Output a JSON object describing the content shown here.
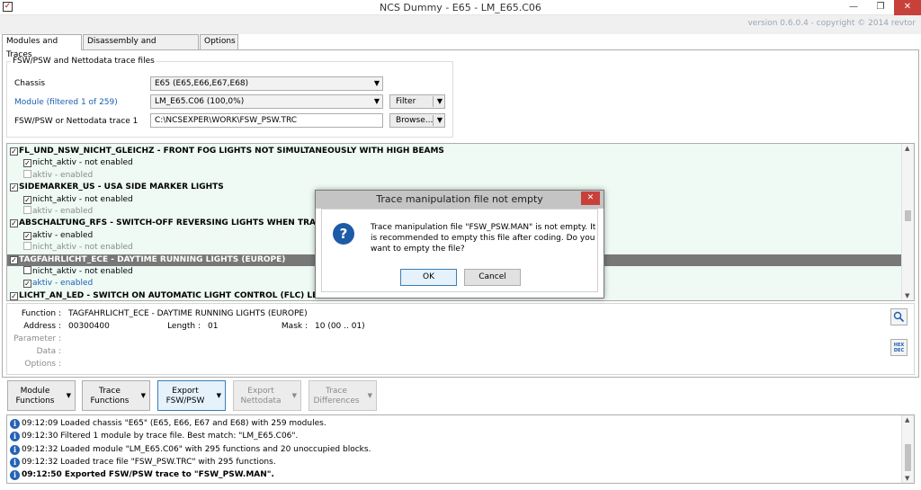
{
  "window": {
    "title": "NCS Dummy - E65 - LM_E65.C06",
    "version": "version 0.6.0.4 - copyright © 2014 revtor",
    "minimize": "—",
    "maximize": "❐",
    "close": "✕"
  },
  "tabs": [
    "Modules and Traces",
    "Disassembly and Checksums",
    "Options"
  ],
  "trace_group": {
    "title": "FSW/PSW and Nettodata trace files",
    "chassis_label": "Chassis",
    "chassis_value": "E65  (E65,E66,E67,E68)",
    "module_label": "Module (filtered 1 of 259)",
    "module_value": "LM_E65.C06  (100,0%)",
    "filter_button": "Filter",
    "trace_label": "FSW/PSW or Nettodata trace 1",
    "trace_value": "C:\\NCSEXPER\\WORK\\FSW_PSW.TRC",
    "browse_button": "Browse..."
  },
  "function_list": [
    {
      "type": "func",
      "text": "FL_UND_NSW_NICHT_GLEICHZ  -  FRONT FOG LIGHTS NOT SIMULTANEOUSLY WITH HIGH BEAMS",
      "checked": true,
      "selected": false
    },
    {
      "type": "opt",
      "text": "nicht_aktiv  -  not enabled",
      "checked": true,
      "state": "normal"
    },
    {
      "type": "opt",
      "text": "aktiv  -  enabled",
      "checked": false,
      "state": "disabled"
    },
    {
      "type": "func",
      "text": "SIDEMARKER_US  -  USA SIDE MARKER LIGHTS",
      "checked": true,
      "selected": false
    },
    {
      "type": "opt",
      "text": "nicht_aktiv  -  not enabled",
      "checked": true,
      "state": "normal"
    },
    {
      "type": "opt",
      "text": "aktiv  -  enabled",
      "checked": false,
      "state": "disabled"
    },
    {
      "type": "func",
      "text": "ABSCHALTUNG_RFS  -  SWITCH-OFF REVERSING LIGHTS WHEN TRAILER ATTACHED",
      "checked": true,
      "selected": false
    },
    {
      "type": "opt",
      "text": "aktiv  -  enabled",
      "checked": true,
      "state": "normal"
    },
    {
      "type": "opt",
      "text": "nicht_aktiv  -  not enabled",
      "checked": false,
      "state": "disabled"
    },
    {
      "type": "func",
      "text": "TAGFAHRLICHT_ECE  -  DAYTIME RUNNING LIGHTS (EUROPE)",
      "checked": true,
      "selected": true
    },
    {
      "type": "opt",
      "text": "nicht_aktiv  -  not enabled",
      "checked": false,
      "state": "normal"
    },
    {
      "type": "opt",
      "text": "aktiv  -  enabled",
      "checked": true,
      "state": "blue"
    },
    {
      "type": "func",
      "text": "LICHT_AN_LED  -  SWITCH ON AUTOMATIC LIGHT CONTROL (FLC) LED WHEN HEADLIGHTS ON",
      "checked": true,
      "selected": false
    }
  ],
  "details": {
    "function_label": "Function :",
    "function_value": "TAGFAHRLICHT_ECE  -  DAYTIME RUNNING LIGHTS (EUROPE)",
    "address_label": "Address :",
    "address_value": "00300400",
    "length_label": "Length :",
    "length_value": "01",
    "mask_label": "Mask :",
    "mask_value": "10  (00 .. 01)",
    "parameter_label": "Parameter :",
    "data_label": "Data :",
    "options_label": "Options :",
    "hexdec_top": "HEX",
    "hexdec_bottom": "DEC"
  },
  "action_buttons": [
    {
      "line1": "Module",
      "line2": "Functions",
      "state": "normal"
    },
    {
      "line1": "Trace",
      "line2": "Functions",
      "state": "normal"
    },
    {
      "line1": "Export",
      "line2": "FSW/PSW",
      "state": "active"
    },
    {
      "line1": "Export",
      "line2": "Nettodata",
      "state": "disabled"
    },
    {
      "line1": "Trace",
      "line2": "Differences",
      "state": "disabled"
    }
  ],
  "log": [
    {
      "time": "09:12:09",
      "text": "Loaded chassis \"E65\" (E65, E66, E67 and E68) with 259 modules.",
      "bold": false
    },
    {
      "time": "09:12:30",
      "text": "Filtered 1 module by trace file. Best match: \"LM_E65.C06\".",
      "bold": false
    },
    {
      "time": "09:12:32",
      "text": "Loaded module \"LM_E65.C06\" with 295 functions and 20 unoccupied blocks.",
      "bold": false
    },
    {
      "time": "09:12:32",
      "text": "Loaded trace file \"FSW_PSW.TRC\" with 295 functions.",
      "bold": false
    },
    {
      "time": "09:12:50",
      "text": "Exported FSW/PSW trace to \"FSW_PSW.MAN\".",
      "bold": true
    }
  ],
  "dialog": {
    "title": "Trace manipulation file not empty",
    "message": "Trace manipulation file \"FSW_PSW.MAN\" is not empty. It is recommended to empty this file after coding. Do you want to empty the file?",
    "ok": "OK",
    "cancel": "Cancel",
    "close": "✕"
  }
}
